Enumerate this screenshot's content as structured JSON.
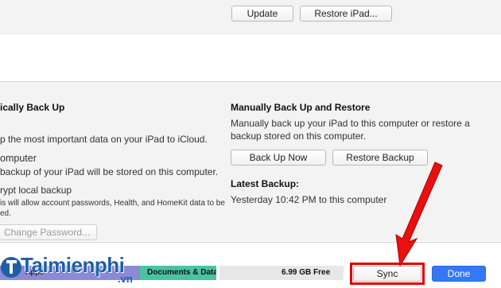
{
  "top": {
    "update_label": "Update",
    "restore_label": "Restore iPad..."
  },
  "auto_backup": {
    "heading": "ically Back Up",
    "icloud_desc": "p the most important data on your iPad to iCloud.",
    "computer_label": "omputer",
    "computer_desc": "backup of your iPad will be stored on this computer.",
    "encrypt_label": "rypt local backup",
    "encrypt_desc": "is will allow account passwords, Health, and HomeKit data to be",
    "encrypt_desc2": "ed.",
    "change_password_label": "Change Password..."
  },
  "manual_backup": {
    "heading": "Manually Back Up and Restore",
    "desc_line1": "Manually back up your iPad to this computer or restore a",
    "desc_line2": "backup stored on this computer.",
    "back_up_now_label": "Back Up Now",
    "restore_backup_label": "Restore Backup",
    "latest_heading": "Latest Backup:",
    "latest_value": "Yesterday 10:42 PM to this computer"
  },
  "storage_bar": {
    "apps_label": "Apps",
    "docs_label": "Documents & Data",
    "free_label": "6.99 GB Free"
  },
  "actions": {
    "sync_label": "Sync",
    "done_label": "Done"
  },
  "watermark": {
    "brand": "Taimienphi",
    "tld": ".vn"
  },
  "colors": {
    "apps": "#8a8ad6",
    "docs": "#4ac3a2",
    "free": "#e7e7e7",
    "done": "#3478f6",
    "highlight": "#e00000"
  }
}
